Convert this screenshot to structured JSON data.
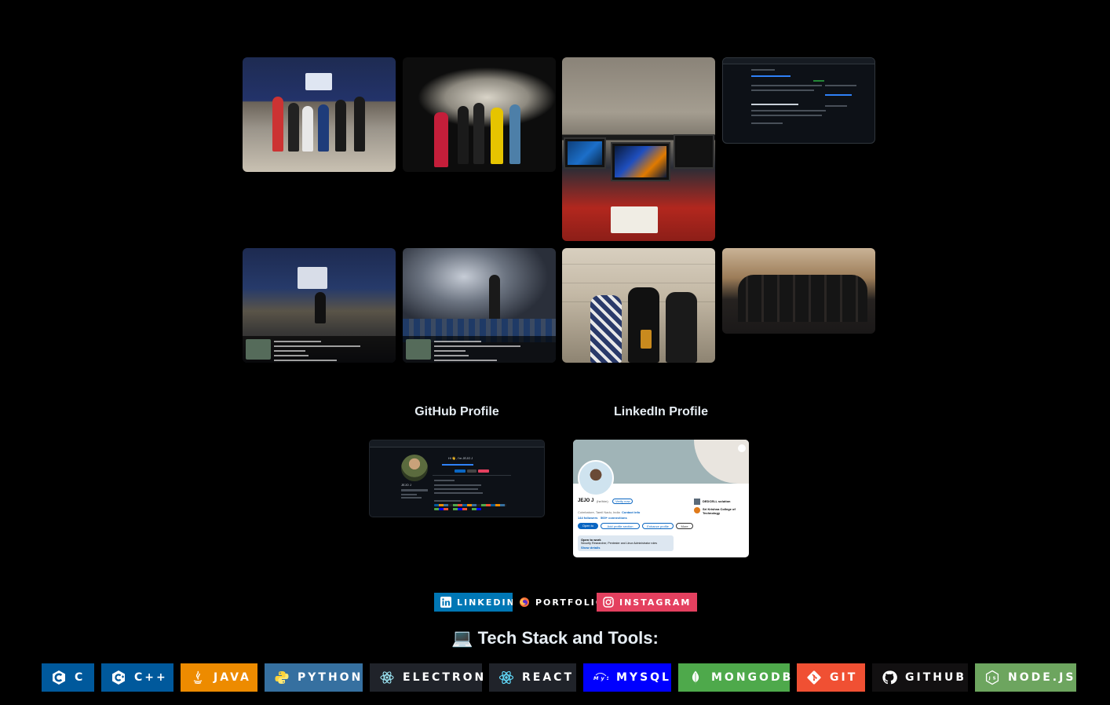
{
  "profiles": {
    "github_title": "GitHub Profile",
    "linkedin_title": "LinkedIn Profile",
    "linkedin_card": {
      "name": "JEJO J",
      "pronoun": "(he/him)",
      "verify": "Verify now",
      "location": "Coimbatore, Tamil Nadu, India",
      "contact": "Contact info",
      "followers": "144 followers",
      "connections": "500+ connections",
      "btn_open": "Open to",
      "btn_add": "Add profile section",
      "btn_enhance": "Enhance profile",
      "btn_more": "More",
      "org1": "DEDCELL solution",
      "org2": "Sri Krishna College of Technology",
      "open_title": "Open to work",
      "open_desc": "Security Researcher, Pentester and Linux Administrator roles",
      "open_link": "Show details"
    },
    "github_card": {
      "greeting": "Hi 👋, I'm JEJO J",
      "name": "JEJO J"
    }
  },
  "social": {
    "linkedin": "LINKEDIN",
    "portfolio": "PORTFOLIO",
    "instagram": "INSTAGRAM"
  },
  "tech_heading": "💻 Tech Stack and Tools:",
  "tech": [
    {
      "label": "C",
      "color": "#00599C",
      "icon": "c-icon"
    },
    {
      "label": "C++",
      "color": "#00599C",
      "icon": "cpp-icon"
    },
    {
      "label": "JAVA",
      "color": "#ED8B00",
      "icon": "java-icon"
    },
    {
      "label": "PYTHON",
      "color": "#3670A0",
      "icon": "python-icon"
    },
    {
      "label": "ELECTRON",
      "color": "#191970",
      "icon": "electron-icon"
    },
    {
      "label": "REACT",
      "color": "#20232a",
      "icon": "react-icon"
    },
    {
      "label": "MYSQL",
      "color": "#0000ff",
      "icon": "mysql-icon"
    },
    {
      "label": "MONGODB",
      "color": "#4ea94b",
      "icon": "mongodb-icon"
    },
    {
      "label": "GIT",
      "color": "#F05033",
      "icon": "git-icon"
    },
    {
      "label": "GITHUB",
      "color": "#121011",
      "icon": "github-icon"
    },
    {
      "label": "NODE.JS",
      "color": "#6DA55F",
      "icon": "nodejs-icon"
    }
  ],
  "gps": {
    "photo5": [
      "Ondipudur, Tamil Nadu, India",
      "1591, Sarath Nagar, Ondipudur, Coimbatore, Tamil Nadu 641016, India",
      "Lat 11.004301°",
      "Long 77.049517°",
      "28/08/24 09:13 AM GMT +05:30"
    ],
    "photo6": [
      "Ondipudur, Tamil Nadu, India",
      "1591, Sarath Nagar, Ondipudur, Coimbatore, Tamil Nadu 641016, India",
      "Lat 11.004302°",
      "Long 77.049498°",
      "28/08/24 09:15 AM GMT +05:30"
    ],
    "stamp": "GPS Map Camera"
  }
}
